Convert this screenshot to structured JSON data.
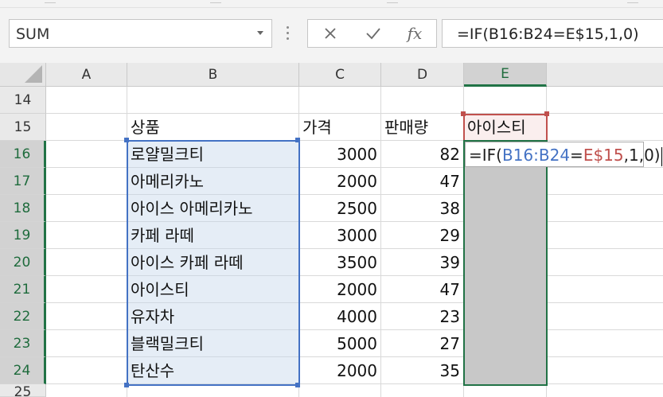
{
  "namebox": {
    "value": "SUM"
  },
  "formula_bar": {
    "cancel_icon": "close-icon",
    "enter_icon": "check-icon",
    "fx_label": "fx",
    "formula": "=IF(B16:B24=E$15,1,0)"
  },
  "columns": [
    "A",
    "B",
    "C",
    "D",
    "E"
  ],
  "rows": [
    "14",
    "15",
    "16",
    "17",
    "18",
    "19",
    "20",
    "21",
    "22",
    "23",
    "24",
    "25"
  ],
  "headers": {
    "product": "상품",
    "price": "가격",
    "sales": "판매량",
    "target": "아이스티"
  },
  "table": [
    {
      "product": "로얄밀크티",
      "price": "3000",
      "sales": "82"
    },
    {
      "product": "아메리카노",
      "price": "2000",
      "sales": "47"
    },
    {
      "product": "아이스 아메리카노",
      "price": "2500",
      "sales": "38"
    },
    {
      "product": "카페 라떼",
      "price": "3000",
      "sales": "29"
    },
    {
      "product": "아이스 카페 라떼",
      "price": "3500",
      "sales": "39"
    },
    {
      "product": "아이스티",
      "price": "2000",
      "sales": "47"
    },
    {
      "product": "유자차",
      "price": "4000",
      "sales": "23"
    },
    {
      "product": "블랙밀크티",
      "price": "5000",
      "sales": "27"
    },
    {
      "product": "탄산수",
      "price": "2000",
      "sales": "35"
    }
  ],
  "edit_cell": {
    "prefix": "=IF(",
    "ref1": "B16:B24",
    "eq": "=",
    "ref2": "E$15",
    "suffix": ",1,0)"
  },
  "colors": {
    "excel_green": "#217346",
    "ref_blue": "#4472c4",
    "ref_red": "#c0504d"
  }
}
